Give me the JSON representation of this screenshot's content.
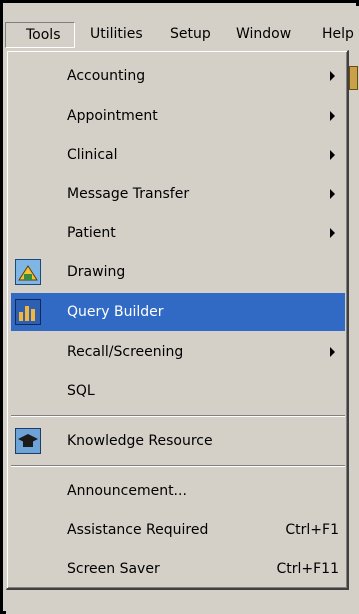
{
  "menubar": {
    "items": [
      {
        "label": "Tools",
        "active": true
      },
      {
        "label": "Utilities"
      },
      {
        "label": "Setup"
      },
      {
        "label": "Window"
      },
      {
        "label": "Help"
      }
    ]
  },
  "tools_menu": {
    "items": [
      {
        "label": "Accounting",
        "submenu": true
      },
      {
        "label": "Appointment",
        "submenu": true
      },
      {
        "label": "Clinical",
        "submenu": true
      },
      {
        "label": "Message Transfer",
        "submenu": true
      },
      {
        "label": "Patient",
        "submenu": true
      },
      {
        "label": "Drawing",
        "icon": "drawing-icon"
      },
      {
        "label": "Query Builder",
        "icon": "query-builder-icon",
        "highlighted": true
      },
      {
        "label": "Recall/Screening",
        "submenu": true
      },
      {
        "label": "SQL"
      },
      {
        "label": "Knowledge Resource",
        "icon": "knowledge-resource-icon"
      },
      {
        "label": "Announcement..."
      },
      {
        "label": "Assistance Required",
        "shortcut": "Ctrl+F1"
      },
      {
        "label": "Screen Saver",
        "shortcut": "Ctrl+F11"
      }
    ]
  },
  "colors": {
    "menu_bg": "#d4d0c8",
    "highlight": "#316ac5",
    "highlight_text": "#ffffff"
  }
}
